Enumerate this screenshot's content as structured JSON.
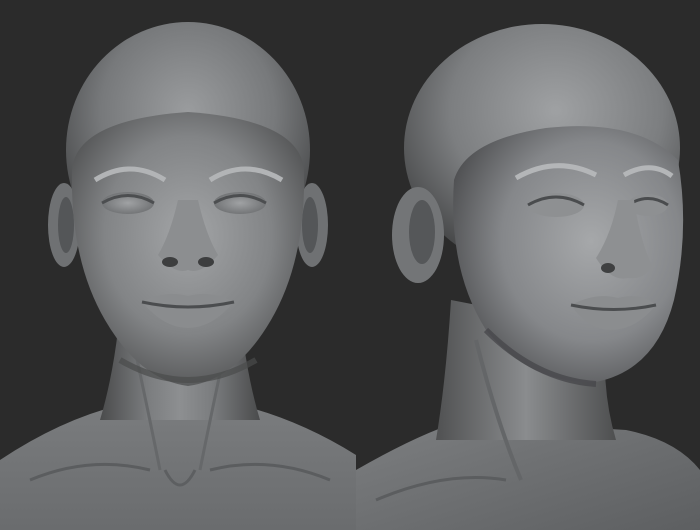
{
  "scene": {
    "background_color": "#2b2b2b",
    "material_color": "#8a8c8e",
    "views": [
      {
        "id": "front",
        "content": "sculpted-head-front"
      },
      {
        "id": "three-quarter",
        "content": "sculpted-head-three-quarter"
      }
    ]
  }
}
